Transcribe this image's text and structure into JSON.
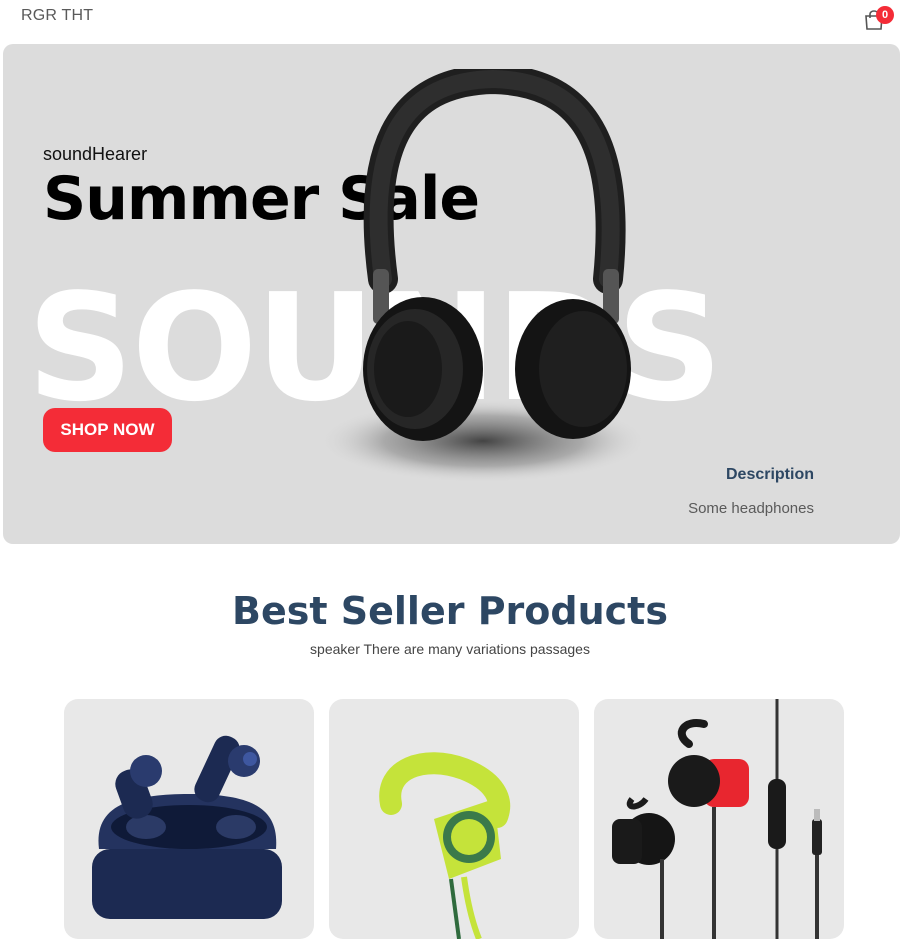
{
  "navbar": {
    "brand": "RGR THT",
    "cart_count": "0"
  },
  "hero": {
    "subtitle": "soundHearer",
    "title": "Summer Sale",
    "background_word": "SOUNDS",
    "button_label": "SHOP NOW",
    "description_label": "Description",
    "description_text": "Some headphones"
  },
  "section": {
    "title": "Best Seller Products",
    "subtitle": "speaker There are many variations passages"
  },
  "products": [
    {
      "name": "wireless-earbuds",
      "icon": "earbuds-case-icon"
    },
    {
      "name": "sport-earphone",
      "icon": "sport-earphone-icon"
    },
    {
      "name": "wired-earphones",
      "icon": "wired-earphones-icon"
    }
  ],
  "colors": {
    "accent": "#f42c37",
    "heading": "#2d4763",
    "hero_bg": "#dcdcdc",
    "card_bg": "#e8e8e8"
  }
}
